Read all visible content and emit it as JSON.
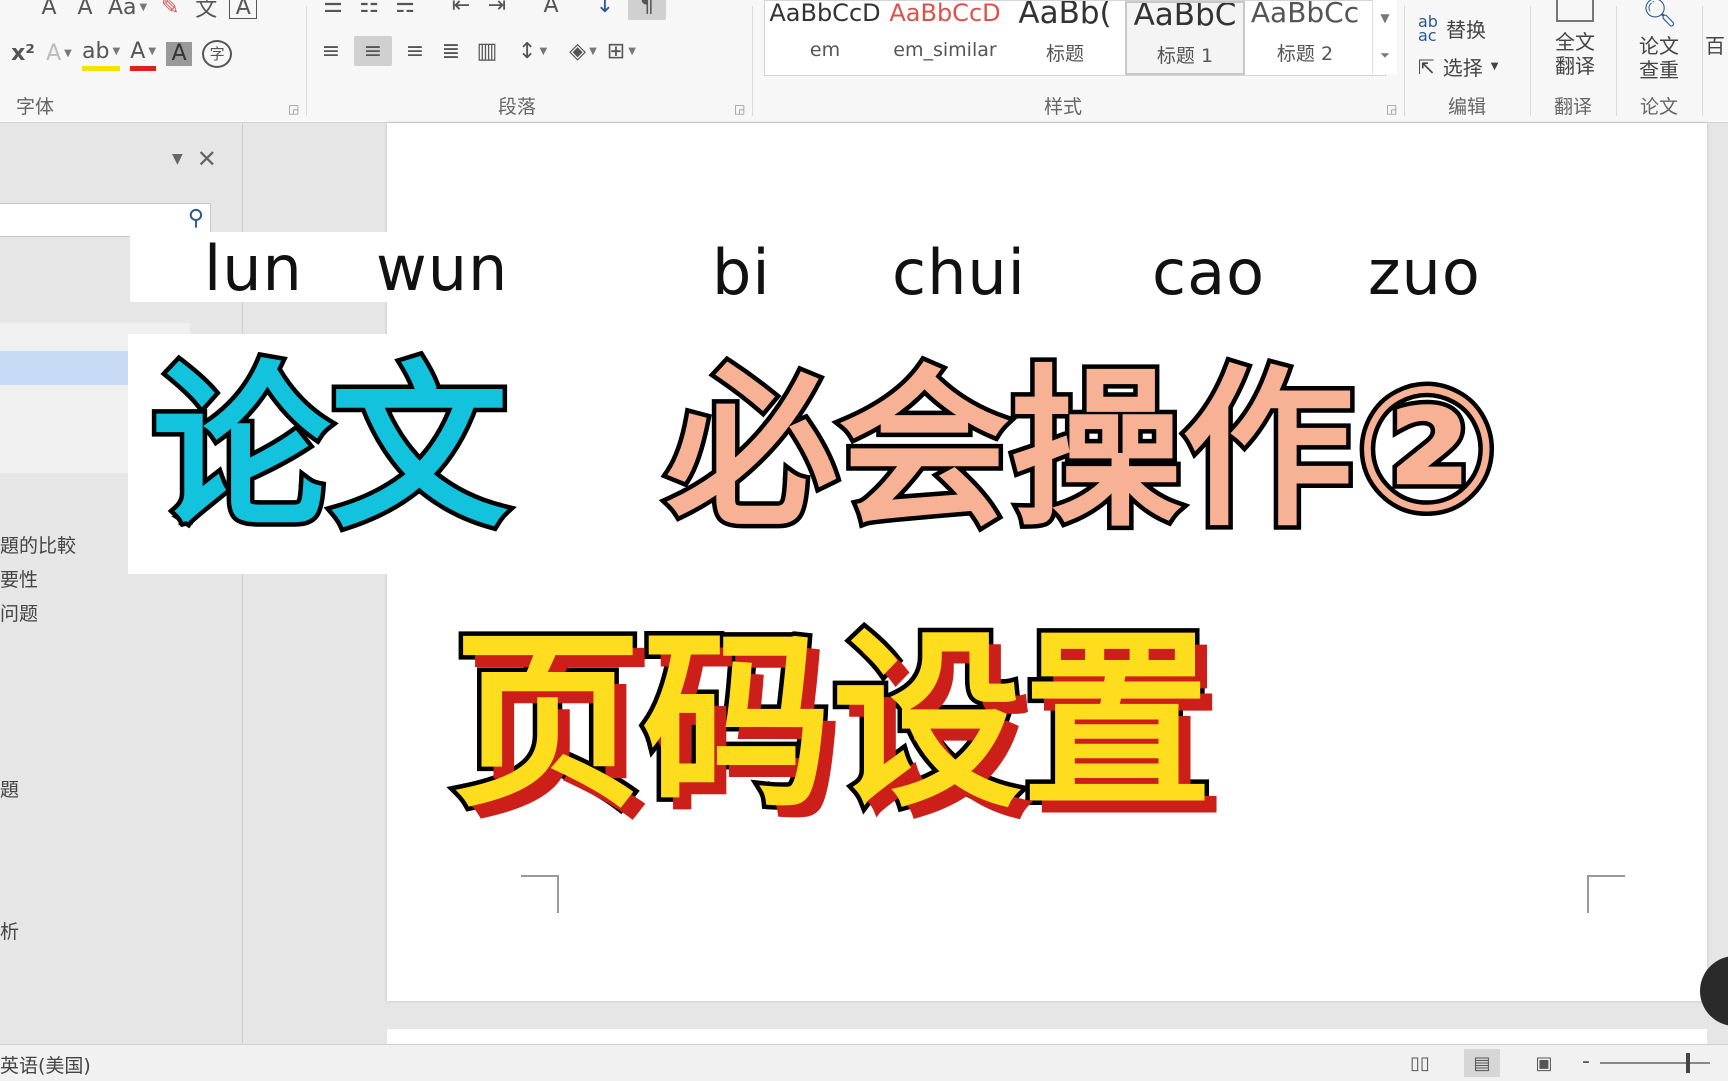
{
  "ribbon": {
    "groups": {
      "font": "字体",
      "paragraph": "段落",
      "styles": "样式",
      "editing": "编辑",
      "translate": "翻译",
      "thesis": "论文"
    },
    "font_tools_row1": [
      "A",
      "A",
      "Aa"
    ],
    "font_tools_row2": [
      "x²",
      "A",
      "ab",
      "A",
      "A",
      "字"
    ],
    "styles_gallery": [
      {
        "sample": "AaBbCcD",
        "name": "em"
      },
      {
        "sample": "AaBbCcD",
        "name": "em_similar"
      },
      {
        "sample": "AaBb(",
        "name": "标题"
      },
      {
        "sample": "AaBbC",
        "name": "标题 1"
      },
      {
        "sample": "AaBbCc",
        "name": "标题 2"
      }
    ],
    "editing": {
      "replace": "替换",
      "select": "选择"
    },
    "big_buttons": [
      {
        "line1": "全文",
        "line2": "翻译"
      },
      {
        "line1": "论文",
        "line2": "查重"
      },
      {
        "line1": "百",
        "line2": ""
      }
    ]
  },
  "nav_pane": {
    "items": [
      "題的比較",
      "要性",
      "问题",
      "題",
      "析"
    ]
  },
  "overlay": {
    "pinyin": [
      "lun",
      "wun",
      "bi",
      "chui",
      "cao",
      "zuo"
    ],
    "title_part1": "论文",
    "title_part2": "必会操作②",
    "subtitle": "页码设置"
  },
  "status_bar": {
    "language": "英语(美国)"
  },
  "colors": {
    "title_cyan": "#13c3de",
    "title_peach": "#f7b295",
    "subtitle_yellow": "#fedc1e",
    "subtitle_shadow": "#cc1f1a"
  }
}
